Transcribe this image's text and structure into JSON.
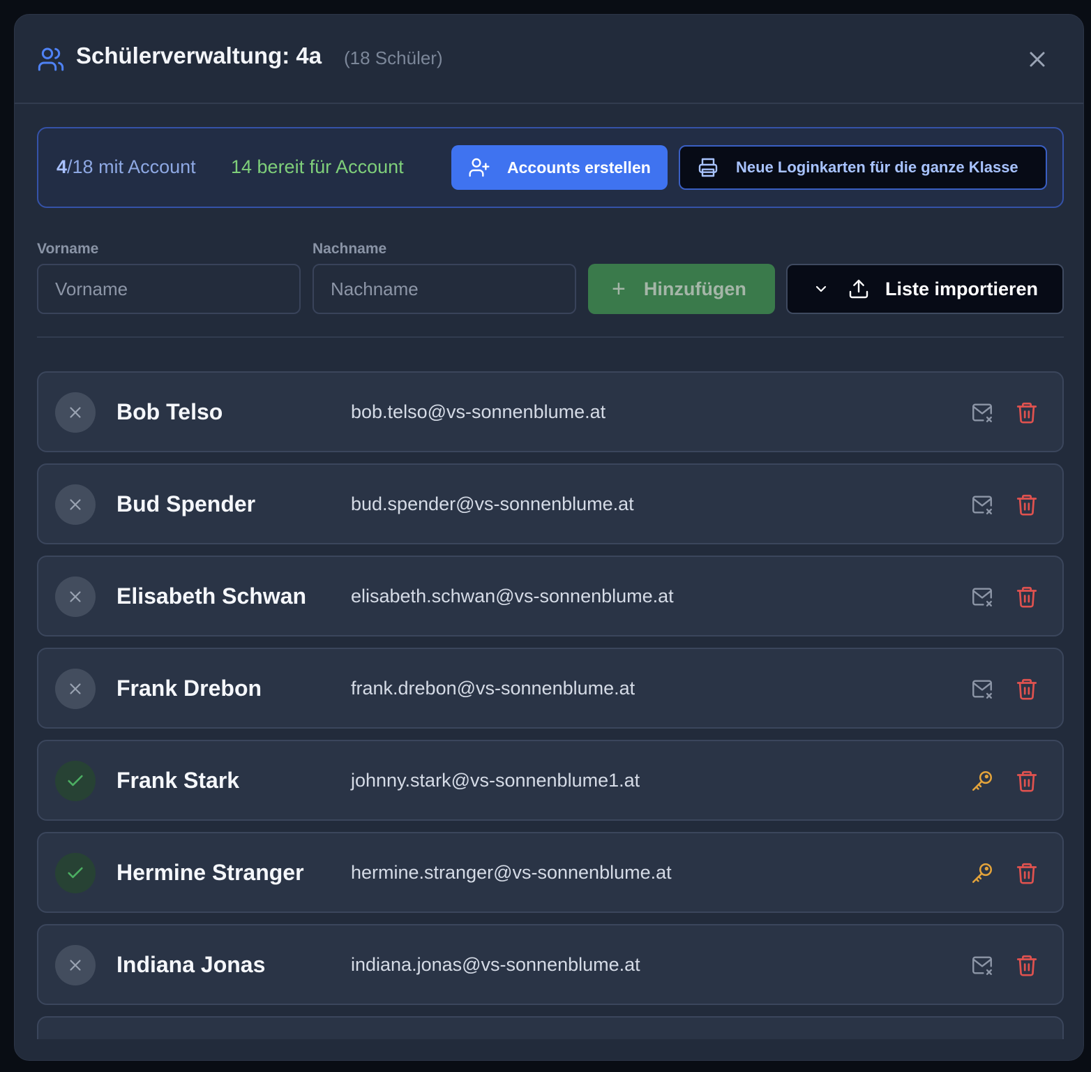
{
  "header": {
    "title": "Schülerverwaltung: 4a",
    "count": "(18 Schüler)"
  },
  "account_bar": {
    "with_account_num": "4",
    "with_account_rest": "/18 mit Account",
    "ready": "14 bereit für Account",
    "create_label": "Accounts erstellen",
    "print_label": "Neue Loginkarten für die ganze Klasse"
  },
  "form": {
    "first_label": "Vorname",
    "first_placeholder": "Vorname",
    "last_label": "Nachname",
    "last_placeholder": "Nachname",
    "add_label": "Hinzufügen",
    "import_label": "Liste importieren"
  },
  "students": [
    {
      "name": "Bob Telso",
      "email": "bob.telso@vs-sonnenblume.at",
      "has_account": false
    },
    {
      "name": "Bud Spender",
      "email": "bud.spender@vs-sonnenblume.at",
      "has_account": false
    },
    {
      "name": "Elisabeth Schwan",
      "email": "elisabeth.schwan@vs-sonnenblume.at",
      "has_account": false
    },
    {
      "name": "Frank Drebon",
      "email": "frank.drebon@vs-sonnenblume.at",
      "has_account": false
    },
    {
      "name": "Frank Stark",
      "email": "johnny.stark@vs-sonnenblume1.at",
      "has_account": true
    },
    {
      "name": "Hermine Stranger",
      "email": "hermine.stranger@vs-sonnenblume.at",
      "has_account": true
    },
    {
      "name": "Indiana Jonas",
      "email": "indiana.jonas@vs-sonnenblume.at",
      "has_account": false
    }
  ],
  "colors": {
    "accent": "#3f73f0",
    "success": "#7fcf7a",
    "danger": "#e0524f",
    "key": "#e3a33b"
  },
  "icons": {
    "header": "users-icon",
    "close": "close-icon",
    "create": "user-plus-icon",
    "print": "printer-icon",
    "add": "plus-icon",
    "import_chevron": "chevron-down-icon",
    "import": "upload-icon",
    "no_account": "x-icon",
    "has_account": "check-icon",
    "mail": "mail-x-icon",
    "key": "key-icon",
    "delete": "trash-icon"
  }
}
